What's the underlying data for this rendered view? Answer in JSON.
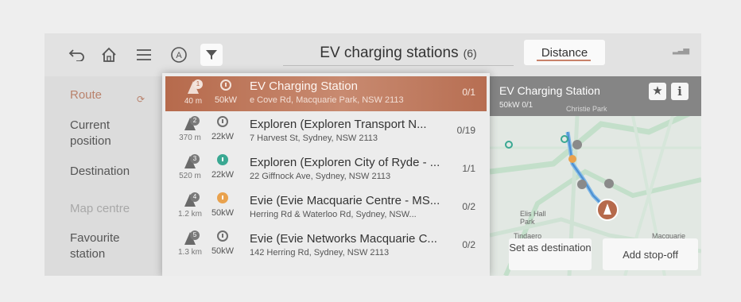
{
  "header": {
    "back_icon": "back-arrow-icon",
    "home_icon": "home-icon",
    "menu_icon": "menu-icon",
    "auto_icon_label": "A",
    "filter_icon": "filter-icon",
    "title": "EV charging stations",
    "count": "(6)",
    "sort_label": "Distance",
    "accent_color": "#c9826a"
  },
  "sidebar": {
    "items": [
      {
        "label": "Route"
      },
      {
        "label": "Current position"
      },
      {
        "label": "Destination"
      },
      {
        "label": "Map centre"
      },
      {
        "label": "Favourite station"
      }
    ]
  },
  "list": {
    "rows": [
      {
        "index": "1",
        "distance": "40 m",
        "power": "50kW",
        "plug": "grey",
        "name": "EV Charging Station",
        "address": "e Cove Rd, Macquarie Park, NSW 2113",
        "available": "0/1"
      },
      {
        "index": "2",
        "distance": "370 m",
        "power": "22kW",
        "plug": "grey",
        "name": "Exploren (Exploren Transport N...",
        "address": "7 Harvest St, Sydney, NSW 2113",
        "available": "0/19"
      },
      {
        "index": "3",
        "distance": "520 m",
        "power": "22kW",
        "plug": "teal",
        "name": "Exploren (Exploren City of Ryde - ...",
        "address": "22 Giffnock Ave, Sydney, NSW 2113",
        "available": "1/1"
      },
      {
        "index": "4",
        "distance": "1.2 km",
        "power": "50kW",
        "plug": "orange",
        "name": "Evie (Evie Macquarie Centre - MS...",
        "address": "Herring Rd & Waterloo Rd, Sydney, NSW...",
        "available": "0/2"
      },
      {
        "index": "5",
        "distance": "1.3 km",
        "power": "50kW",
        "plug": "grey",
        "name": "Evie (Evie Networks Macquarie C...",
        "address": "142 Herring Rd, Sydney, NSW 2113",
        "available": "0/2"
      }
    ]
  },
  "map_panel": {
    "title": "EV Charging Station",
    "subtitle": "50kW 0/1",
    "star_icon": "star-icon",
    "info_label": "i",
    "labels": [
      "Christie Park",
      "Elis Hall Park",
      "Tindaero",
      "Macquarie"
    ],
    "set_destination": "Set as destination",
    "add_stopoff": "Add stop-off"
  }
}
